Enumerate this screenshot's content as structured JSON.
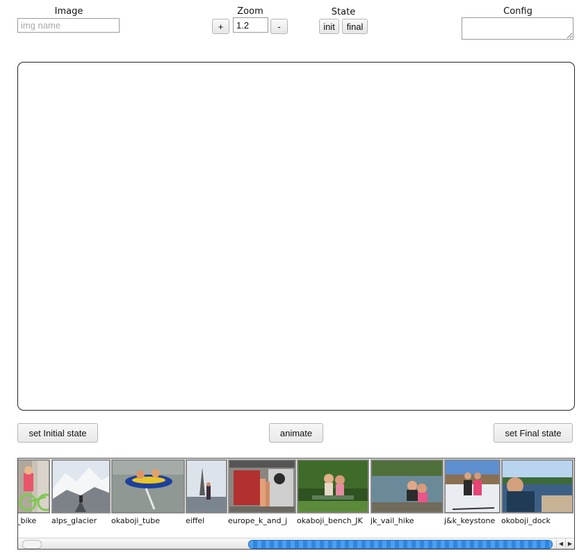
{
  "toolbar": {
    "image_label": "Image",
    "image_input_placeholder": "img name",
    "image_input_value": "",
    "zoom_label": "Zoom",
    "zoom_plus": "+",
    "zoom_value": "1.2",
    "zoom_minus": "-",
    "state_label": "State",
    "state_init": "init",
    "state_final": "final",
    "config_label": "Config",
    "config_value": ""
  },
  "actions": {
    "set_initial": "set Initial state",
    "animate": "animate",
    "set_final": "set Final state"
  },
  "gallery": {
    "items": [
      {
        "caption": "_bike"
      },
      {
        "caption": "alps_glacier"
      },
      {
        "caption": "okaboji_tube"
      },
      {
        "caption": "eiffel"
      },
      {
        "caption": "europe_k_and_j"
      },
      {
        "caption": "okaboji_bench_JK"
      },
      {
        "caption": "jk_vail_hike"
      },
      {
        "caption": "j&k_keystone"
      },
      {
        "caption": "okoboji_dock"
      }
    ],
    "scroll_position_fraction": 0.43,
    "scrollbar_colors": {
      "thumb": "#3a93e8",
      "track": "#f3f3f3"
    }
  }
}
